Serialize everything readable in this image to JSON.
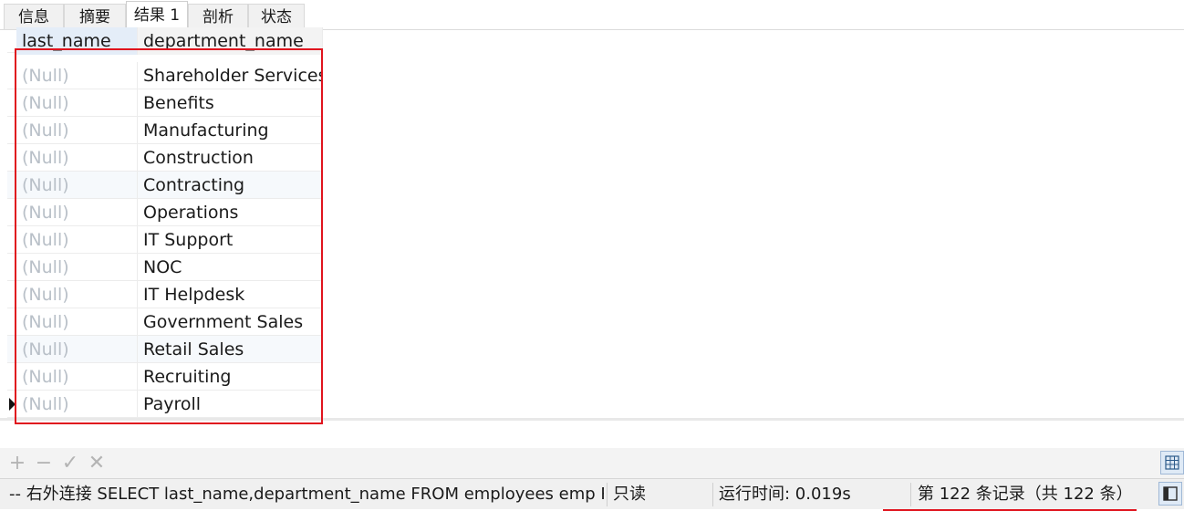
{
  "tabs": [
    {
      "label": "信息"
    },
    {
      "label": "摘要"
    },
    {
      "label": "结果 1",
      "active": true
    },
    {
      "label": "剖析"
    },
    {
      "label": "状态"
    }
  ],
  "grid": {
    "columns": [
      "last_name",
      "department_name"
    ],
    "rows": [
      {
        "last_name": "(Null)",
        "department_name": "Shareholder Services"
      },
      {
        "last_name": "(Null)",
        "department_name": "Benefits"
      },
      {
        "last_name": "(Null)",
        "department_name": "Manufacturing"
      },
      {
        "last_name": "(Null)",
        "department_name": "Construction"
      },
      {
        "last_name": "(Null)",
        "department_name": "Contracting"
      },
      {
        "last_name": "(Null)",
        "department_name": "Operations"
      },
      {
        "last_name": "(Null)",
        "department_name": "IT Support"
      },
      {
        "last_name": "(Null)",
        "department_name": "NOC"
      },
      {
        "last_name": "(Null)",
        "department_name": "IT Helpdesk"
      },
      {
        "last_name": "(Null)",
        "department_name": "Government Sales"
      },
      {
        "last_name": "(Null)",
        "department_name": "Retail Sales"
      },
      {
        "last_name": "(Null)",
        "department_name": "Recruiting"
      },
      {
        "last_name": "(Null)",
        "department_name": "Payroll"
      }
    ],
    "current_row_marker": "row-indicator-triangle"
  },
  "toolbar": {
    "add": "+",
    "delete": "−",
    "apply": "✓",
    "cancel": "✕"
  },
  "status": {
    "query": "-- 右外连接 SELECT  last_name,department_name FROM employees emp RIGHT",
    "mode": "只读",
    "runtime": "运行时间: 0.019s",
    "record": "第 122 条记录（共 122 条）"
  },
  "colors": {
    "highlight": "#e0141e",
    "null_text": "#b9c0c8"
  }
}
